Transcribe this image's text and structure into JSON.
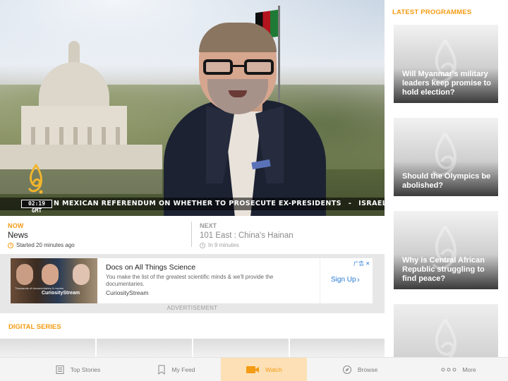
{
  "video": {
    "ticker_time": "02:19 GMT",
    "ticker_items": [
      "N MEXICAN REFERENDUM ON WHETHER TO PROSECUTE EX-PRESIDENTS",
      "-",
      "ISRAEL'S SUPREME COURT AC"
    ]
  },
  "schedule": {
    "now": {
      "label": "NOW",
      "title": "News",
      "time": "Started 20 minutes ago"
    },
    "next": {
      "label": "NEXT",
      "title": "101 East : China's Hainan",
      "time": "In 9 minutes"
    }
  },
  "ad": {
    "image_brand": "CuriosityStream",
    "image_caption": "Thousands of documentaries & movies",
    "title": "Docs on All Things Science",
    "description": "You make the list of the greatest scientific minds & we'll provide the documentaries.",
    "source": "CuriosityStream",
    "cta": "Sign Up",
    "choice": "广告",
    "label": "ADVERTISEMENT"
  },
  "digital_series": {
    "title": "DIGITAL SERIES"
  },
  "latest": {
    "title": "LATEST PROGRAMMES",
    "items": [
      {
        "title": "Will Myanmar's military leaders keep promise to hold election?"
      },
      {
        "title": "Should the Olympics be abolished?"
      },
      {
        "title": "Why is Central African Republic struggling to find peace?"
      }
    ]
  },
  "tabs": {
    "top_stories": "Top Stories",
    "my_feed": "My Feed",
    "watch": "Watch",
    "browse": "Browse",
    "more": "More"
  },
  "colors": {
    "accent": "#f39b13",
    "active_tab_bg": "#fde0b5",
    "link": "#2679d4"
  }
}
